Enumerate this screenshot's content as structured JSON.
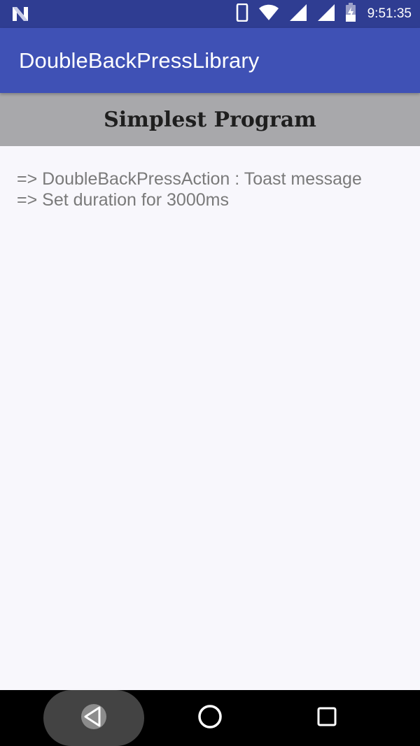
{
  "status_bar": {
    "time": "9:51:35",
    "icons": [
      "notification-n-icon",
      "phone-vibrate-icon",
      "wifi-icon",
      "signal-icon",
      "signal-icon-2",
      "battery-charging-icon"
    ]
  },
  "app_bar": {
    "title": "DoubleBackPressLibrary"
  },
  "section": {
    "title": "Simplest Program"
  },
  "content": {
    "lines": [
      "=> DoubleBackPressAction : Toast message",
      "=> Set duration for 3000ms"
    ]
  },
  "nav_bar": {
    "buttons": [
      "back-icon",
      "home-icon",
      "recents-icon"
    ]
  },
  "colors": {
    "status_bar": "#2f3d92",
    "app_bar": "#3f51b5",
    "section_header": "#a8a8ab",
    "background": "#f8f7fc",
    "body_text": "#7a7a7a"
  }
}
